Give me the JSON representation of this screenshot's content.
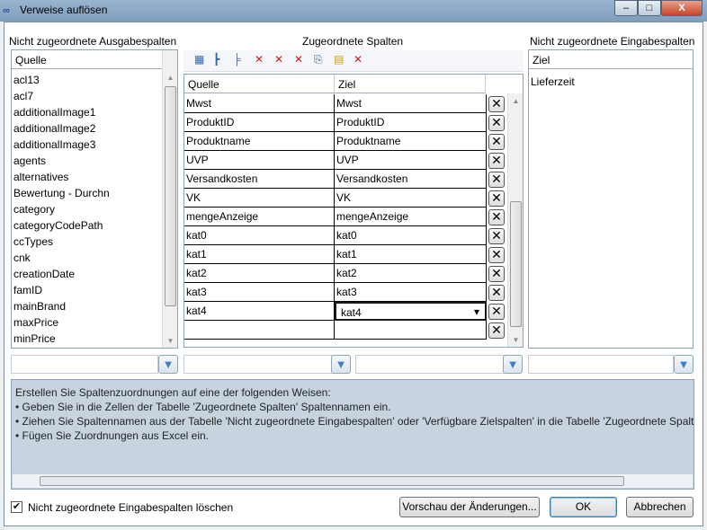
{
  "window": {
    "title": "Verweise auflösen",
    "minimize": "–",
    "maximize": "□",
    "close": "X"
  },
  "left": {
    "label": "Nicht zugeordnete Ausgabespalten",
    "header": "Quelle",
    "items": [
      "acl13",
      "acl7",
      "additionalImage1",
      "additionalImage2",
      "additionalImage3",
      "agents",
      "alternatives",
      "Bewertung - Durchn",
      "category",
      "categoryCodePath",
      "ccTypes",
      "cnk",
      "creationDate",
      "famID",
      "mainBrand",
      "maxPrice",
      "minPrice"
    ]
  },
  "middle": {
    "label": "Zugeordnete Spalten",
    "col_source": "Quelle",
    "col_target": "Ziel",
    "rows": [
      [
        "Mwst",
        "Mwst"
      ],
      [
        "ProduktID",
        "ProduktID"
      ],
      [
        "Produktname",
        "Produktname"
      ],
      [
        "UVP",
        "UVP"
      ],
      [
        "Versandkosten",
        "Versandkosten"
      ],
      [
        "VK",
        "VK"
      ],
      [
        "mengeAnzeige",
        "mengeAnzeige"
      ],
      [
        "kat0",
        "kat0"
      ],
      [
        "kat1",
        "kat1"
      ],
      [
        "kat2",
        "kat2"
      ],
      [
        "kat3",
        "kat3"
      ],
      [
        "kat4",
        "kat4"
      ],
      [
        "",
        ""
      ]
    ],
    "delete_glyph": "✕"
  },
  "right": {
    "label": "Nicht zugeordnete Eingabespalten",
    "header": "Ziel",
    "items": [
      "Lieferzeit"
    ]
  },
  "info": {
    "lines": [
      "Erstellen Sie Spaltenzuordnungen auf eine der folgenden Weisen:",
      "• Geben Sie in die Zellen der Tabelle 'Zugeordnete Spalten' Spaltennamen ein.",
      "• Ziehen Sie Spaltennamen aus der Tabelle 'Nicht zugeordnete Eingabespalten' oder 'Verfügbare Zielspalten' in die Tabelle 'Zugeordnete Spalten'.",
      "• Fügen Sie Zuordnungen aus Excel ein."
    ]
  },
  "footer": {
    "checkbox_label": "Nicht zugeordnete Eingabespalten löschen",
    "checked": true,
    "preview": "Vorschau der Änderungen...",
    "ok": "OK",
    "cancel": "Abbrechen"
  }
}
